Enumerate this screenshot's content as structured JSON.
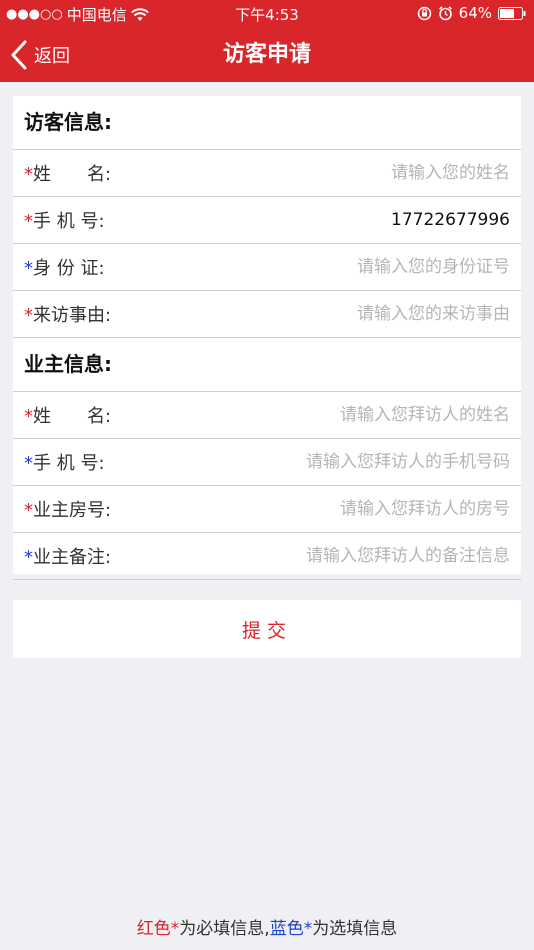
{
  "status_bar": {
    "carrier": "中国电信",
    "time": "下午4:53",
    "battery": "64%"
  },
  "nav": {
    "back_label": "返回",
    "title": "访客申请"
  },
  "visitor_section": {
    "title": "访客信息:",
    "fields": [
      {
        "star": "*",
        "label": "姓　　名:",
        "value": "",
        "placeholder": "请输入您的姓名"
      },
      {
        "star": "*",
        "label": "手 机 号:",
        "value": "17722677996",
        "placeholder": ""
      },
      {
        "star": "*",
        "label": "身 份 证:",
        "value": "",
        "placeholder": "请输入您的身份证号"
      },
      {
        "star": "*",
        "label": "来访事由:",
        "value": "",
        "placeholder": "请输入您的来访事由"
      }
    ]
  },
  "owner_section": {
    "title": "业主信息:",
    "fields": [
      {
        "star": "*",
        "label": "姓　　名:",
        "value": "",
        "placeholder": "请输入您拜访人的姓名"
      },
      {
        "star": "*",
        "label": "手 机 号:",
        "value": "",
        "placeholder": "请输入您拜访人的手机号码"
      },
      {
        "star": "*",
        "label": "业主房号:",
        "value": "",
        "placeholder": "请输入您拜访人的房号"
      },
      {
        "star": "*",
        "label": "业主备注:",
        "value": "",
        "placeholder": "请输入您拜访人的备注信息"
      }
    ]
  },
  "submit_label": "提交",
  "footer": {
    "red_word": "红色",
    "star": "*",
    "text1": "为必填信息,",
    "blue_word": "蓝色",
    "text2": "为选填信息"
  },
  "colors": {
    "brand_red": "#d8262b",
    "optional_blue": "#1e3fd0"
  },
  "icons": [
    "signal-dots-icon",
    "wifi-icon",
    "lock-rotation-icon",
    "alarm-icon",
    "battery-icon",
    "chevron-left-icon"
  ]
}
